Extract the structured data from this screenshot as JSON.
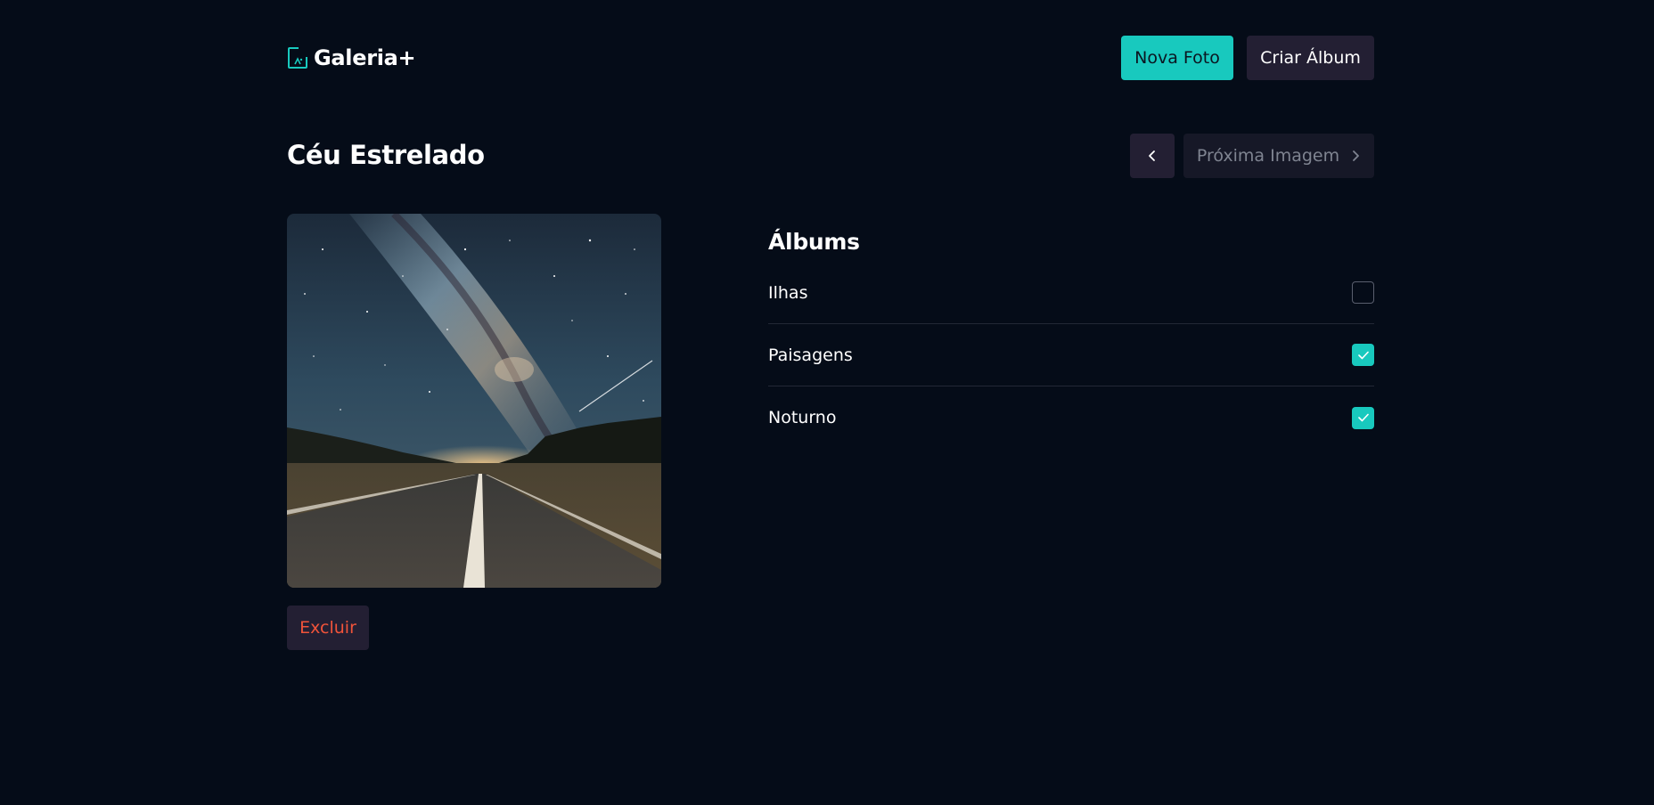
{
  "app": {
    "name": "Galeria+",
    "logo_icon": "image-frame-icon",
    "accent_color": "#18c9be",
    "danger_color": "#f0533a"
  },
  "header": {
    "new_photo_label": "Nova Foto",
    "create_album_label": "Criar Álbum"
  },
  "photo": {
    "title": "Céu Estrelado",
    "image_subject": "milky-way-over-road"
  },
  "navigation": {
    "prev_icon": "chevron-left-icon",
    "next_label": "Próxima Imagem",
    "next_icon": "chevron-right-icon",
    "next_disabled": true
  },
  "actions": {
    "delete_label": "Excluir"
  },
  "albums": {
    "title": "Álbums",
    "items": [
      {
        "label": "Ilhas",
        "checked": false
      },
      {
        "label": "Paisagens",
        "checked": true
      },
      {
        "label": "Noturno",
        "checked": true
      }
    ]
  }
}
